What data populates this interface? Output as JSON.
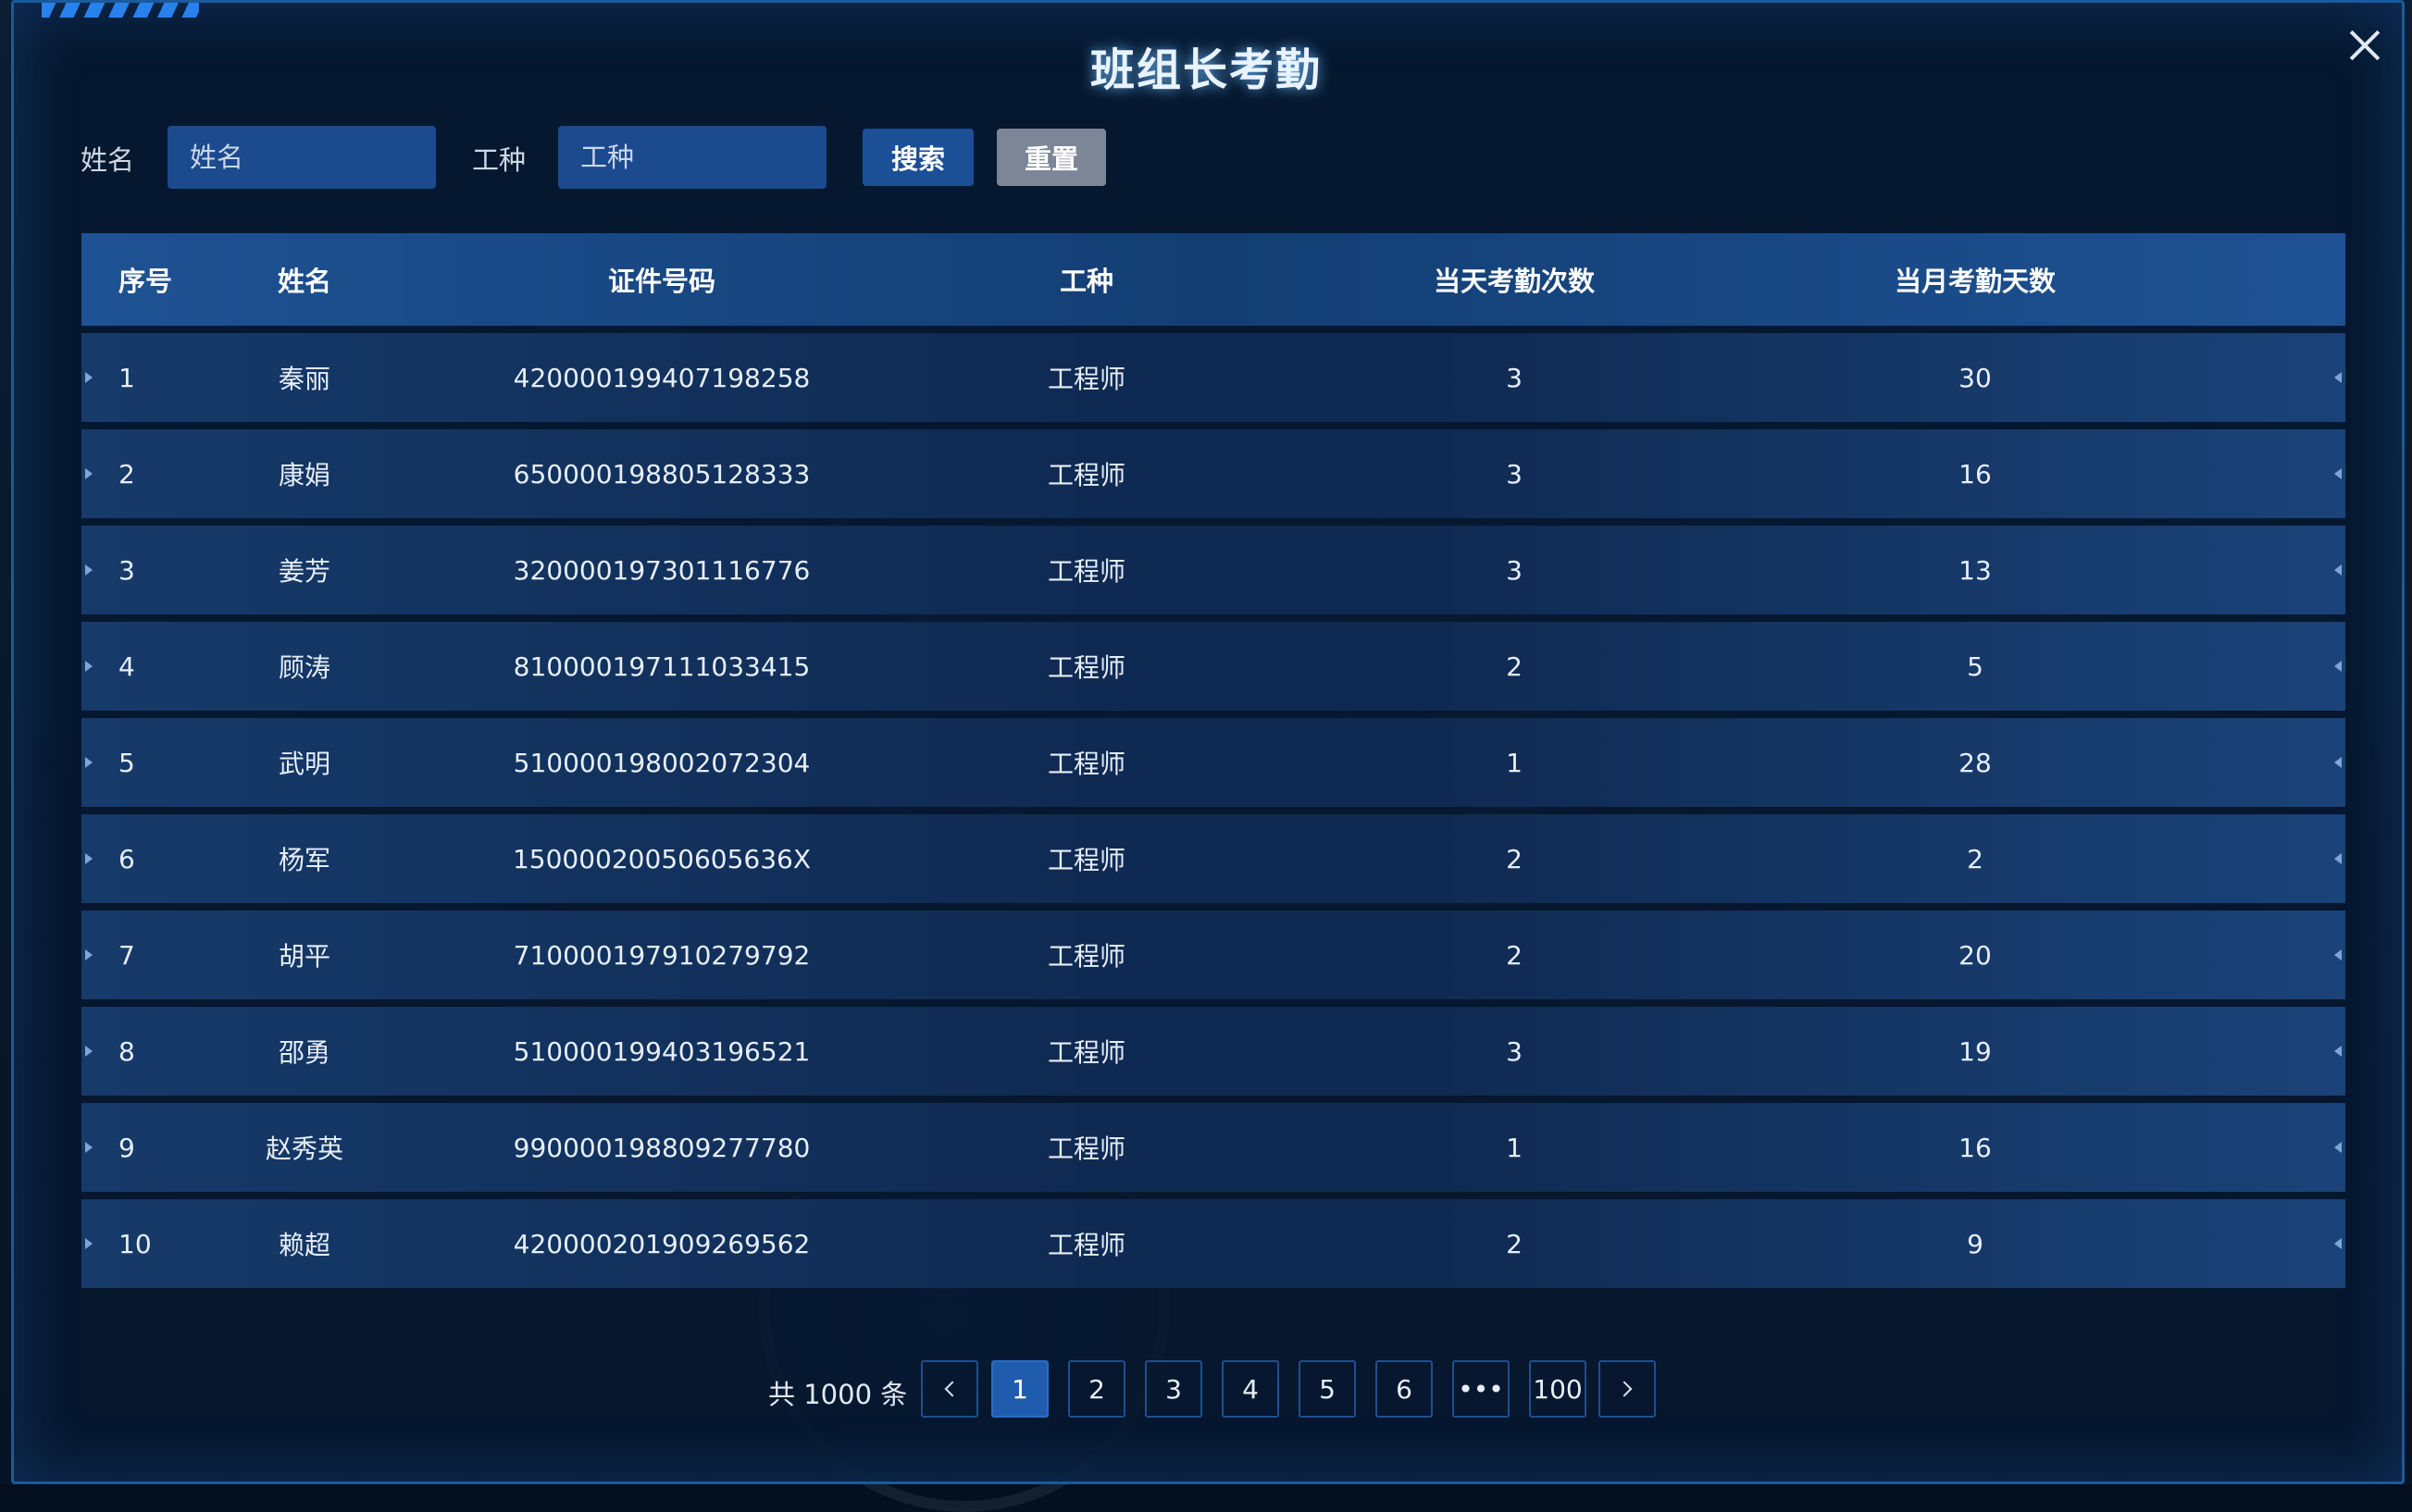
{
  "dialog": {
    "title": "班组长考勤"
  },
  "filters": {
    "name_label": "姓名",
    "name_placeholder": "姓名",
    "trade_label": "工种",
    "trade_placeholder": "工种",
    "search_label": "搜索",
    "reset_label": "重置"
  },
  "table": {
    "columns": [
      "序号",
      "姓名",
      "证件号码",
      "工种",
      "当天考勤次数",
      "当月考勤天数"
    ],
    "rows": [
      [
        "1",
        "秦丽",
        "420000199407198258",
        "工程师",
        "3",
        "30"
      ],
      [
        "2",
        "康娟",
        "650000198805128333",
        "工程师",
        "3",
        "16"
      ],
      [
        "3",
        "姜芳",
        "320000197301116776",
        "工程师",
        "3",
        "13"
      ],
      [
        "4",
        "顾涛",
        "810000197111033415",
        "工程师",
        "2",
        "5"
      ],
      [
        "5",
        "武明",
        "510000198002072304",
        "工程师",
        "1",
        "28"
      ],
      [
        "6",
        "杨军",
        "15000020050605636X",
        "工程师",
        "2",
        "2"
      ],
      [
        "7",
        "胡平",
        "710000197910279792",
        "工程师",
        "2",
        "20"
      ],
      [
        "8",
        "邵勇",
        "510000199403196521",
        "工程师",
        "3",
        "19"
      ],
      [
        "9",
        "赵秀英",
        "990000198809277780",
        "工程师",
        "1",
        "16"
      ],
      [
        "10",
        "赖超",
        "420000201909269562",
        "工程师",
        "2",
        "9"
      ]
    ]
  },
  "pagination": {
    "total_text": "共 1000 条",
    "pages": [
      "1",
      "2",
      "3",
      "4",
      "5",
      "6",
      "•••",
      "100"
    ],
    "current": "1"
  }
}
